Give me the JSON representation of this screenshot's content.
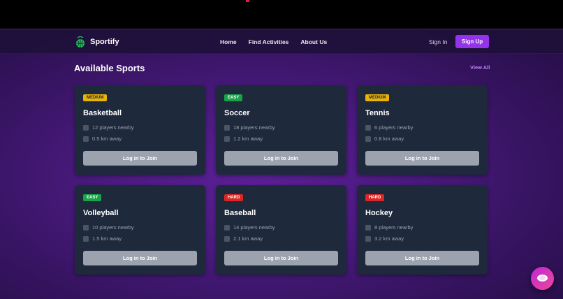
{
  "app": {
    "name": "Sportify"
  },
  "nav": {
    "links": [
      {
        "label": "Home"
      },
      {
        "label": "Find Activities"
      },
      {
        "label": "About Us"
      }
    ],
    "sign_in": "Sign In",
    "sign_up": "Sign Up"
  },
  "section": {
    "title": "Available Sports",
    "view_all": "View All"
  },
  "cards": [
    {
      "difficulty": "MEDIUM",
      "level": "medium",
      "sport": "Basketball",
      "players": "12 players nearby",
      "distance": "0.5 km away",
      "action": "Log in to Join"
    },
    {
      "difficulty": "EASY",
      "level": "easy",
      "sport": "Soccer",
      "players": "18 players nearby",
      "distance": "1.2 km away",
      "action": "Log in to Join"
    },
    {
      "difficulty": "MEDIUM",
      "level": "medium",
      "sport": "Tennis",
      "players": "6 players nearby",
      "distance": "0.8 km away",
      "action": "Log in to Join"
    },
    {
      "difficulty": "EASY",
      "level": "easy",
      "sport": "Volleyball",
      "players": "10 players nearby",
      "distance": "1.5 km away",
      "action": "Log in to Join"
    },
    {
      "difficulty": "HARD",
      "level": "hard",
      "sport": "Baseball",
      "players": "14 players nearby",
      "distance": "2.1 km away",
      "action": "Log in to Join"
    },
    {
      "difficulty": "HARD",
      "level": "hard",
      "sport": "Hockey",
      "players": "8 players nearby",
      "distance": "3.2 km away",
      "action": "Log in to Join"
    }
  ],
  "colors": {
    "accent": "#9333ea",
    "easy": "#16a34a",
    "medium": "#eab308",
    "hard": "#dc2626",
    "card": "#1e293b"
  },
  "icons": {
    "brand": "sportify-logo-icon",
    "players": "users-icon",
    "distance": "location-pin-icon",
    "chat": "chat-bubble-icon"
  }
}
